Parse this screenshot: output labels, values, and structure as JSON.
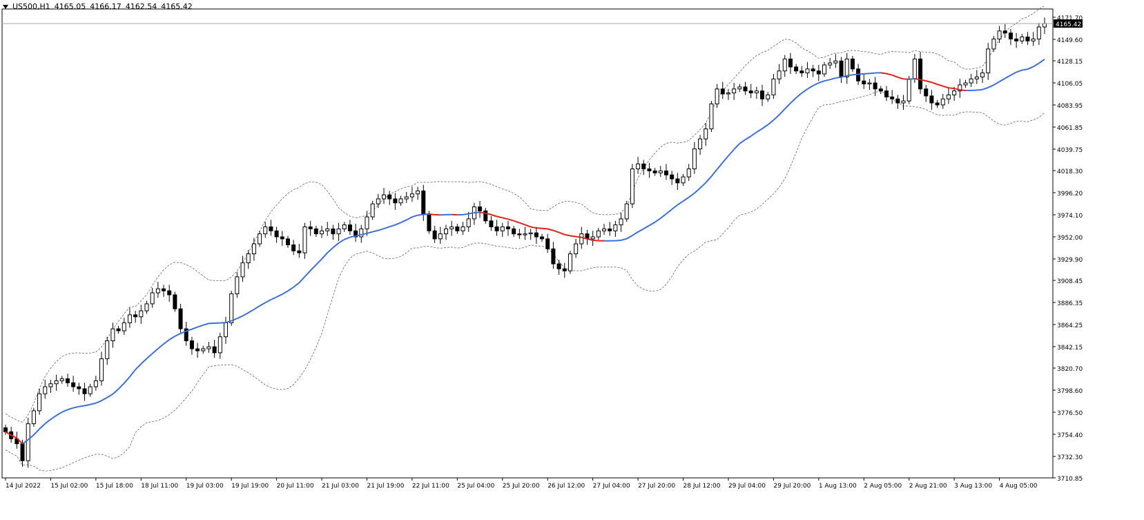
{
  "header": {
    "symbol": "US500,H1",
    "open": "4165.05",
    "high": "4166.17",
    "low": "4162.54",
    "close": "4165.42"
  },
  "colors": {
    "background": "#ffffff",
    "candle": "#000000",
    "bb_dashed": "#808080",
    "ma_up": "#3a6fd8",
    "ma_down": "#e0201a",
    "price_line": "#9aaab5",
    "price_tag_bg": "#000000",
    "price_tag_text": "#ffffff"
  },
  "chart_data": {
    "type": "candlestick",
    "symbol": "US500",
    "timeframe": "H1",
    "current_price": 4165.42,
    "current_price_label": "4165.42",
    "y_range": [
      3710.85,
      4180
    ],
    "y_ticks": [
      {
        "value": 4171.7,
        "label": "4171.70"
      },
      {
        "value": 4149.6,
        "label": "4149.60"
      },
      {
        "value": 4128.15,
        "label": "4128.15"
      },
      {
        "value": 4106.05,
        "label": "4106.05"
      },
      {
        "value": 4083.95,
        "label": "4083.95"
      },
      {
        "value": 4061.85,
        "label": "4061.85"
      },
      {
        "value": 4039.75,
        "label": "4039.75"
      },
      {
        "value": 4018.3,
        "label": "4018.30"
      },
      {
        "value": 3996.2,
        "label": "3996.20"
      },
      {
        "value": 3974.1,
        "label": "3974.10"
      },
      {
        "value": 3952.0,
        "label": "3952.00"
      },
      {
        "value": 3929.9,
        "label": "3929.90"
      },
      {
        "value": 3908.45,
        "label": "3908.45"
      },
      {
        "value": 3886.35,
        "label": "3886.35"
      },
      {
        "value": 3864.25,
        "label": "3864.25"
      },
      {
        "value": 3842.15,
        "label": "3842.15"
      },
      {
        "value": 3820.7,
        "label": "3820.70"
      },
      {
        "value": 3798.6,
        "label": "3798.60"
      },
      {
        "value": 3776.5,
        "label": "3776.50"
      },
      {
        "value": 3754.4,
        "label": "3754.40"
      },
      {
        "value": 3732.3,
        "label": "3732.30"
      },
      {
        "value": 3710.85,
        "label": "3710.85"
      }
    ],
    "x_labels": [
      {
        "index": 0,
        "label": "14 Jul 2022"
      },
      {
        "index": 8,
        "label": "15 Jul 02:00"
      },
      {
        "index": 16,
        "label": "15 Jul 18:00"
      },
      {
        "index": 24,
        "label": "18 Jul 11:00"
      },
      {
        "index": 32,
        "label": "19 Jul 03:00"
      },
      {
        "index": 40,
        "label": "19 Jul 19:00"
      },
      {
        "index": 48,
        "label": "20 Jul 11:00"
      },
      {
        "index": 56,
        "label": "21 Jul 03:00"
      },
      {
        "index": 64,
        "label": "21 Jul 19:00"
      },
      {
        "index": 72,
        "label": "22 Jul 11:00"
      },
      {
        "index": 80,
        "label": "25 Jul 04:00"
      },
      {
        "index": 88,
        "label": "25 Jul 20:00"
      },
      {
        "index": 96,
        "label": "26 Jul 12:00"
      },
      {
        "index": 104,
        "label": "27 Jul 04:00"
      },
      {
        "index": 112,
        "label": "27 Jul 20:00"
      },
      {
        "index": 120,
        "label": "28 Jul 12:00"
      },
      {
        "index": 128,
        "label": "29 Jul 04:00"
      },
      {
        "index": 136,
        "label": "29 Jul 20:00"
      },
      {
        "index": 144,
        "label": "1 Aug 13:00"
      },
      {
        "index": 152,
        "label": "2 Aug 05:00"
      },
      {
        "index": 160,
        "label": "2 Aug 21:00"
      },
      {
        "index": 168,
        "label": "3 Aug 13:00"
      },
      {
        "index": 176,
        "label": "4 Aug 05:00"
      }
    ],
    "closes": [
      3757,
      3750,
      3745,
      3728,
      3765,
      3778,
      3795,
      3802,
      3805,
      3808,
      3810,
      3806,
      3802,
      3800,
      3795,
      3802,
      3808,
      3830,
      3848,
      3860,
      3858,
      3866,
      3874,
      3872,
      3878,
      3885,
      3896,
      3900,
      3898,
      3894,
      3880,
      3860,
      3848,
      3840,
      3838,
      3840,
      3842,
      3836,
      3852,
      3866,
      3895,
      3912,
      3926,
      3935,
      3945,
      3955,
      3962,
      3958,
      3952,
      3950,
      3944,
      3938,
      3936,
      3962,
      3960,
      3955,
      3958,
      3960,
      3955,
      3960,
      3964,
      3958,
      3952,
      3960,
      3972,
      3985,
      3990,
      3994,
      3990,
      3986,
      3990,
      3992,
      3995,
      3998,
      3975,
      3958,
      3950,
      3955,
      3960,
      3962,
      3958,
      3962,
      3970,
      3982,
      3978,
      3968,
      3962,
      3958,
      3962,
      3960,
      3955,
      3954,
      3955,
      3956,
      3952,
      3950,
      3940,
      3925,
      3920,
      3918,
      3935,
      3945,
      3955,
      3950,
      3952,
      3958,
      3960,
      3958,
      3964,
      3970,
      3985,
      4020,
      4025,
      4020,
      4018,
      4016,
      4018,
      4014,
      4010,
      4006,
      4012,
      4020,
      4040,
      4050,
      4060,
      4085,
      4100,
      4095,
      4096,
      4100,
      4102,
      4098,
      4096,
      4098,
      4090,
      4094,
      4110,
      4118,
      4130,
      4122,
      4118,
      4116,
      4120,
      4118,
      4115,
      4124,
      4126,
      4128,
      4112,
      4130,
      4120,
      4108,
      4105,
      4106,
      4100,
      4098,
      4092,
      4090,
      4086,
      4088,
      4110,
      4130,
      4100,
      4093,
      4086,
      4084,
      4090,
      4094,
      4098,
      4104,
      4106,
      4110,
      4112,
      4116,
      4140,
      4150,
      4158,
      4156,
      4150,
      4148,
      4152,
      4148,
      4150,
      4162,
      4165.42
    ],
    "bands_note": "Bollinger bands (dashed) around colored moving average"
  }
}
